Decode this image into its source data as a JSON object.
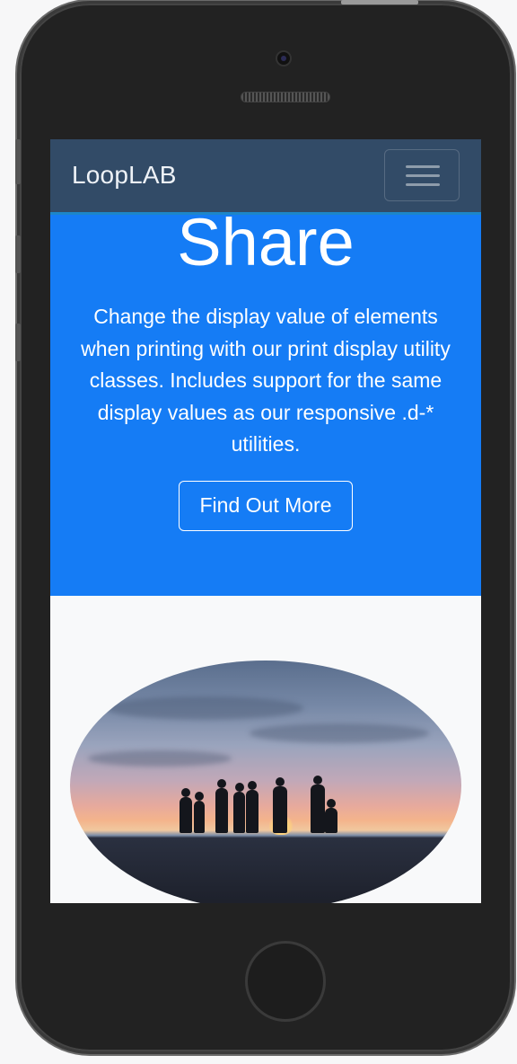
{
  "navbar": {
    "brand": "LoopLAB",
    "toggler_icon": "hamburger-menu-icon"
  },
  "hero": {
    "title": "Share",
    "text": "Change the display value of elements when printing with our print display utility classes. Includes support for the same display values as our responsive .d-* utilities.",
    "button_label": "Find Out More"
  },
  "colors": {
    "navbar_bg": "#324b67",
    "hero_bg": "#157cf5",
    "page_bg": "#f8f9fa"
  }
}
